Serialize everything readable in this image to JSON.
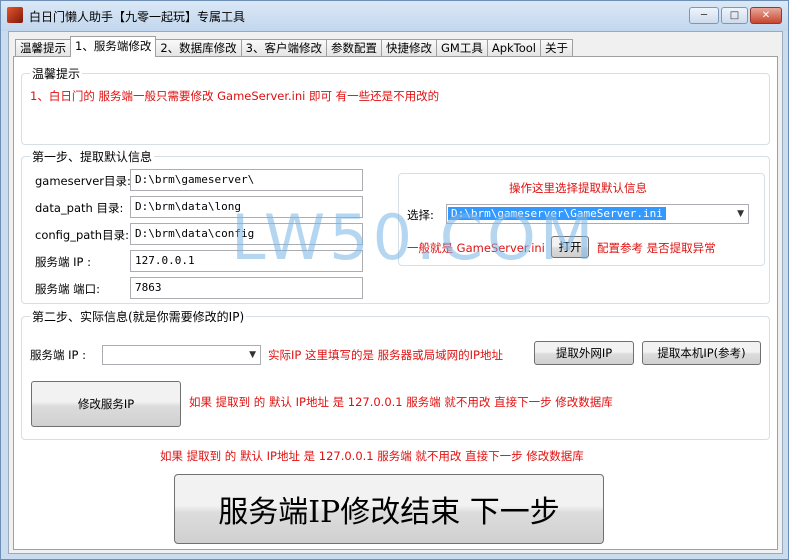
{
  "window": {
    "title": "白日门懒人助手【九零一起玩】专属工具",
    "minimize": "─",
    "maximize": "□",
    "close": "✕"
  },
  "tabs": [
    {
      "label": "温馨提示",
      "active": false
    },
    {
      "label": "1、服务端修改",
      "active": true
    },
    {
      "label": "2、数据库修改",
      "active": false
    },
    {
      "label": "3、客户端修改",
      "active": false
    },
    {
      "label": "参数配置",
      "active": false
    },
    {
      "label": "快捷修改",
      "active": false
    },
    {
      "label": "GM工具",
      "active": false
    },
    {
      "label": "ApkTool",
      "active": false
    },
    {
      "label": "关于",
      "active": false
    }
  ],
  "tips": {
    "title": "温馨提示",
    "text": "1、白日门的 服务端一般只需要修改 GameServer.ini 即可 有一些还是不用改的"
  },
  "step1": {
    "title": "第一步、提取默认信息",
    "fields": [
      {
        "label": "gameserver目录:",
        "value": "D:\\brm\\gameserver\\"
      },
      {
        "label": "data_path 目录:",
        "value": "D:\\brm\\data\\long"
      },
      {
        "label": "config_path目录:",
        "value": "D:\\brm\\data\\config"
      },
      {
        "label": "服务端 IP :",
        "value": "127.0.0.1"
      },
      {
        "label": "服务端 端口:",
        "value": "7863"
      }
    ],
    "extract_title": "操作这里选择提取默认信息",
    "select_label": "选择:",
    "select_value": "D:\\brm\\gameserver\\GameServer.ini",
    "hint_prefix": "一般就是 GameServer.ini",
    "open_button": "打开",
    "hint_suffix": "配置参考 是否提取异常"
  },
  "step2": {
    "title": "第二步、实际信息(就是你需要修改的IP)",
    "ip_label": "服务端 IP :",
    "ip_value": "",
    "ip_note": "实际IP 这里填写的是 服务器或局域网的IP地址",
    "external_ip_button": "提取外网IP",
    "local_ip_button": "提取本机IP(参考)",
    "modify_button": "修改服务IP",
    "modify_note": "如果 提取到 的 默认 IP地址 是 127.0.0.1 服务端 就不用改 直接下一步 修改数据库"
  },
  "footer": {
    "note": "如果 提取到 的 默认 IP地址 是 127.0.0.1 服务端 就不用改 直接下一步 修改数据库",
    "finish_button": "服务端IP修改结束 下一步"
  },
  "watermark": "LW50.COM",
  "colors": {
    "accent_red": "#e01010",
    "selection": "#3399ff",
    "title_bg": "#c9dcf0"
  }
}
